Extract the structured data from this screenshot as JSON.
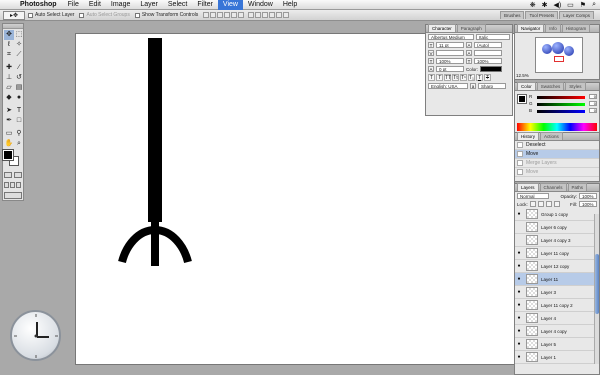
{
  "menubar": {
    "app_name": "Photoshop",
    "items": [
      "File",
      "Edit",
      "Image",
      "Layer",
      "Select",
      "Filter",
      "View",
      "Window",
      "Help"
    ],
    "active_index": 6
  },
  "options_bar": {
    "auto_select_layer": "Auto Select Layer",
    "auto_select_groups": "Auto Select Groups",
    "show_transform_controls": "Show Transform Controls",
    "well_tabs": [
      "Brushes",
      "Tool Presets",
      "Layer Comps"
    ]
  },
  "tools": [
    "move",
    "marquee",
    "lasso",
    "magic-wand",
    "crop",
    "slice",
    "healing",
    "brush",
    "stamp",
    "history-brush",
    "eraser",
    "gradient",
    "blur",
    "dodge",
    "path-select",
    "type",
    "pen",
    "shape",
    "notes",
    "eyedropper",
    "hand",
    "zoom"
  ],
  "colors": {
    "foreground": "#000000",
    "background": "#ffffff",
    "selection": "#b7cbe8",
    "accent": "#3875d7"
  },
  "character": {
    "tabs": [
      "Character",
      "Paragraph"
    ],
    "font_family": "Albertus Medium",
    "font_style": "Italic",
    "font_size": "11 pt",
    "leading": "(Auto)",
    "tracking": "100%",
    "scale_v": "100%",
    "scale_h": "100%",
    "baseline": "0 pt",
    "color_label": "Color:",
    "language": "English: USA",
    "antialias": "Sharp"
  },
  "navigator": {
    "tabs": [
      "Navigator",
      "Info",
      "Histogram"
    ],
    "zoom": "12.5%"
  },
  "color_panel": {
    "tabs": [
      "Color",
      "Swatches",
      "Styles"
    ],
    "r": "0",
    "g": "0",
    "b": "0"
  },
  "history": {
    "tabs": [
      "History",
      "Actions"
    ],
    "items": [
      {
        "label": "Deselect",
        "state": "normal"
      },
      {
        "label": "Move",
        "state": "selected"
      },
      {
        "label": "Merge Layers",
        "state": "dim"
      },
      {
        "label": "Move",
        "state": "dim"
      }
    ]
  },
  "layers": {
    "tabs": [
      "Layers",
      "Channels",
      "Paths"
    ],
    "blend_mode": "Normal",
    "opacity_label": "Opacity:",
    "opacity": "100%",
    "lock_label": "Lock:",
    "fill_label": "Fill:",
    "fill": "100%",
    "items": [
      {
        "name": "Group 1 copy",
        "visible": true
      },
      {
        "name": "Layer 6 copy",
        "visible": false
      },
      {
        "name": "Layer 4 copy 3",
        "visible": false
      },
      {
        "name": "Layer 11 copy",
        "visible": true
      },
      {
        "name": "Layer 12 copy",
        "visible": true
      },
      {
        "name": "Layer 11",
        "visible": true,
        "selected": true
      },
      {
        "name": "Layer 3",
        "visible": true
      },
      {
        "name": "Layer 11 copy 2",
        "visible": true
      },
      {
        "name": "Layer 4",
        "visible": true
      },
      {
        "name": "Layer 4 copy",
        "visible": true
      },
      {
        "name": "Layer 5",
        "visible": true
      },
      {
        "name": "Layer 1",
        "visible": true
      }
    ]
  },
  "canvas_figure": {
    "icon": "stick-figure-anchor-icon"
  },
  "clock": {
    "icon": "clock-icon"
  }
}
